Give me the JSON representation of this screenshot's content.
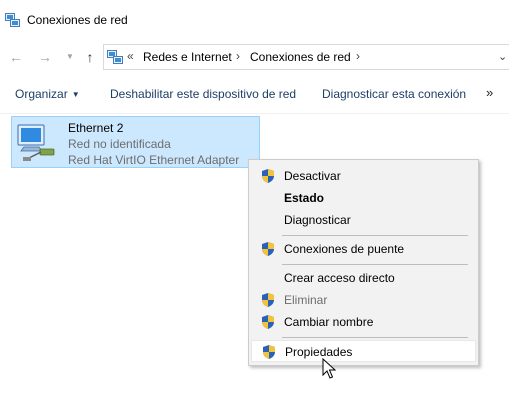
{
  "window": {
    "title": "Conexiones de red"
  },
  "address": {
    "overflow_marker": "«",
    "crumbs": [
      "Redes e Internet",
      "Conexiones de red"
    ],
    "separator": "›"
  },
  "commands": {
    "organize": "Organizar",
    "disable": "Deshabilitar este dispositivo de red",
    "diagnose": "Diagnosticar esta conexión",
    "more": "»"
  },
  "connection": {
    "name": "Ethernet 2",
    "status": "Red no identificada",
    "device": "Red Hat VirtIO Ethernet Adapter"
  },
  "context_menu": {
    "items": [
      {
        "label": "Desactivar",
        "shield": true
      },
      {
        "label": "Estado",
        "bold": true
      },
      {
        "label": "Diagnosticar"
      },
      {
        "label": "Conexiones de puente",
        "shield": true
      },
      {
        "label": "Crear acceso directo"
      },
      {
        "label": "Eliminar",
        "shield": true,
        "disabled": true
      },
      {
        "label": "Cambiar nombre",
        "shield": true
      },
      {
        "label": "Propiedades",
        "shield": true,
        "hovered": true
      }
    ]
  },
  "colors": {
    "selection": "#cce8ff",
    "command_text": "#1e3f66",
    "menu_bg": "#f2f2f2"
  }
}
